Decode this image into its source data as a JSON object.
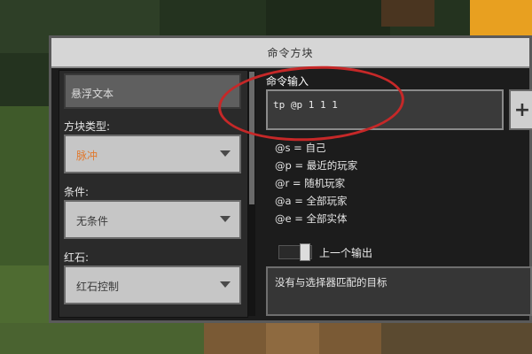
{
  "dialog": {
    "title": "命令方块"
  },
  "left": {
    "hover_text": "悬浮文本",
    "block_type": {
      "label": "方块类型:",
      "value": "脉冲"
    },
    "condition": {
      "label": "条件:",
      "value": "无条件"
    },
    "redstone": {
      "label": "红石:",
      "value": "红石控制"
    }
  },
  "command": {
    "label": "命令输入",
    "value": "tp @p 1 1 1",
    "add_button": "+"
  },
  "selectors": [
    {
      "text": "@s = 自己"
    },
    {
      "text": "@p = 最近的玩家"
    },
    {
      "text": "@r = 随机玩家"
    },
    {
      "text": "@a = 全部玩家"
    },
    {
      "text": "@e = 全部实体"
    }
  ],
  "previous_output": {
    "label": "上一个输出",
    "enabled": true
  },
  "output": {
    "text": "没有与选择器匹配的目标"
  },
  "colors": {
    "annotation_circle": "#c62828",
    "pulse_value": "#e0792e"
  }
}
